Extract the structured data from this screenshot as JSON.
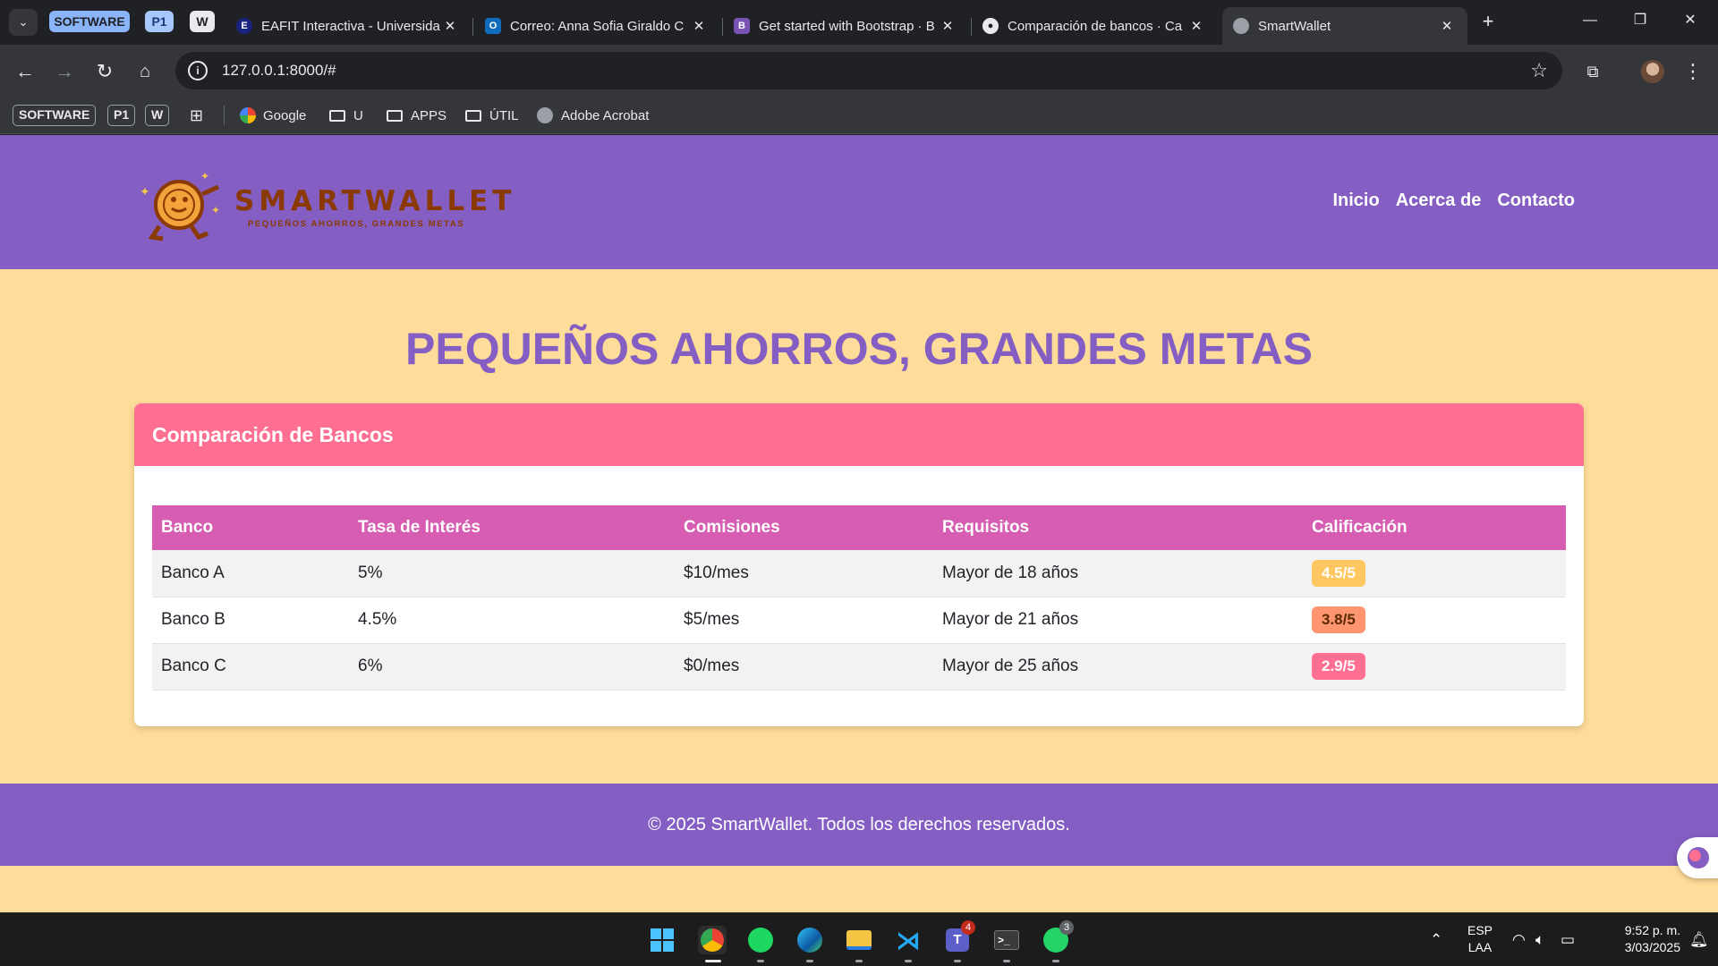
{
  "browser": {
    "tab_groups": [
      {
        "label": "SOFTWARE",
        "color": "#8ab4f8",
        "text_color": "#202124"
      },
      {
        "label": "P1",
        "color": "#a8c7fa",
        "text_color": "#1a3a7a"
      },
      {
        "label": "W",
        "color": "#e8eaed",
        "text_color": "#202124"
      }
    ],
    "tabs": [
      {
        "title": "EAFIT Interactiva - Universidad",
        "favicon": "eafit-icon",
        "favicon_color": "#1a237e"
      },
      {
        "title": "Correo: Anna Sofia Giraldo C",
        "favicon": "outlook-icon",
        "favicon_color": "#0f6cbd"
      },
      {
        "title": "Get started with Bootstrap · B",
        "favicon": "bootstrap-icon",
        "favicon_color": "#7952b3"
      },
      {
        "title": "Comparación de bancos · Ca",
        "favicon": "github-icon",
        "favicon_color": "#e8eaed"
      },
      {
        "title": "SmartWallet",
        "favicon": "globe-icon",
        "favicon_color": "#9aa0a6",
        "active": true
      }
    ],
    "url": "127.0.0.1:8000/#",
    "bookmarks": {
      "chips": [
        "SOFTWARE",
        "P1",
        "W"
      ],
      "google": "Google",
      "folders": [
        "U",
        "APPS",
        "ÚTIL"
      ],
      "acrobat": "Adobe Acrobat"
    }
  },
  "site": {
    "logo_word": "SMARTWALLET",
    "logo_tagline": "PEQUEÑOS AHORROS, GRANDES METAS",
    "nav": [
      "Inicio",
      "Acerca de",
      "Contacto"
    ],
    "hero_title": "PEQUEÑOS AHORROS, GRANDES METAS",
    "card_title": "Comparación de Bancos",
    "table": {
      "headers": [
        "Banco",
        "Tasa de Interés",
        "Comisiones",
        "Requisitos",
        "Calificación"
      ],
      "rows": [
        {
          "banco": "Banco A",
          "tasa": "5%",
          "comisiones": "$10/mes",
          "requisitos": "Mayor de 18 años",
          "calificacion": "4.5/5"
        },
        {
          "banco": "Banco B",
          "tasa": "4.5%",
          "comisiones": "$5/mes",
          "requisitos": "Mayor de 21 años",
          "calificacion": "3.8/5"
        },
        {
          "banco": "Banco C",
          "tasa": "6%",
          "comisiones": "$0/mes",
          "requisitos": "Mayor de 25 años",
          "calificacion": "2.9/5"
        }
      ]
    },
    "footer": "© 2025 SmartWallet. Todos los derechos reservados.",
    "colors": {
      "primary": "#845ec2",
      "background": "#fedc99",
      "card_header": "#ff6f91",
      "table_header": "#d65db1",
      "badge_high": "#ffc75f",
      "badge_mid": "#ff9671",
      "badge_low": "#ff6f91"
    }
  },
  "taskbar": {
    "language": "ESP",
    "layout": "LAA",
    "time": "9:52 p. m.",
    "date": "3/03/2025",
    "teams_badge": "4",
    "whatsapp_badge": "3"
  }
}
